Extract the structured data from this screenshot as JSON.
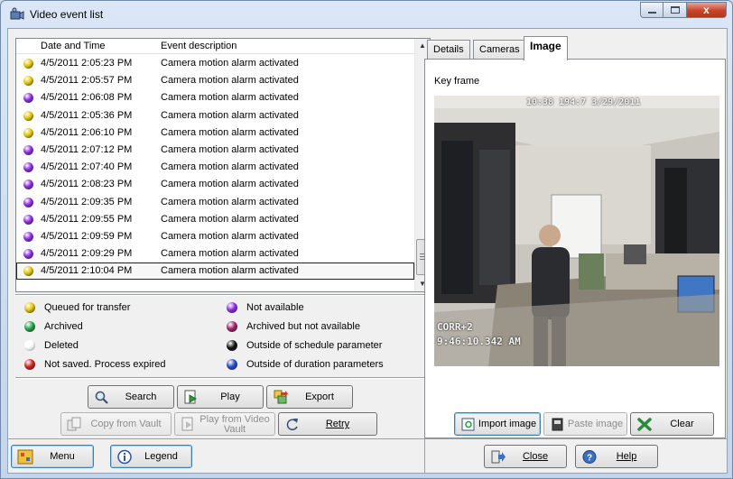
{
  "window": {
    "title": "Video event list",
    "close_glyph": "x"
  },
  "list": {
    "columns": [
      "Date and Time",
      "Event description"
    ],
    "rows": [
      {
        "datetime": "4/5/2011 2:05:23 PM",
        "description": "Camera motion alarm activated",
        "status": "queued"
      },
      {
        "datetime": "4/5/2011 2:05:57 PM",
        "description": "Camera motion alarm activated",
        "status": "queued"
      },
      {
        "datetime": "4/5/2011 2:06:08 PM",
        "description": "Camera motion alarm activated",
        "status": "not-available"
      },
      {
        "datetime": "4/5/2011 2:05:36 PM",
        "description": "Camera motion alarm activated",
        "status": "queued"
      },
      {
        "datetime": "4/5/2011 2:06:10 PM",
        "description": "Camera motion alarm activated",
        "status": "queued"
      },
      {
        "datetime": "4/5/2011 2:07:12 PM",
        "description": "Camera motion alarm activated",
        "status": "not-available"
      },
      {
        "datetime": "4/5/2011 2:07:40 PM",
        "description": "Camera motion alarm activated",
        "status": "not-available"
      },
      {
        "datetime": "4/5/2011 2:08:23 PM",
        "description": "Camera motion alarm activated",
        "status": "not-available"
      },
      {
        "datetime": "4/5/2011 2:09:35 PM",
        "description": "Camera motion alarm activated",
        "status": "not-available"
      },
      {
        "datetime": "4/5/2011 2:09:55 PM",
        "description": "Camera motion alarm activated",
        "status": "not-available"
      },
      {
        "datetime": "4/5/2011 2:09:59 PM",
        "description": "Camera motion alarm activated",
        "status": "not-available"
      },
      {
        "datetime": "4/5/2011 2:09:29 PM",
        "description": "Camera motion alarm activated",
        "status": "not-available"
      },
      {
        "datetime": "4/5/2011 2:10:04 PM",
        "description": "Camera motion alarm activated",
        "status": "queued",
        "selected": true
      }
    ]
  },
  "legend": [
    {
      "label": "Queued for transfer",
      "color": "#e2c600",
      "icon": "yellow-dot-icon"
    },
    {
      "label": "Not available",
      "color": "#8a2be2",
      "icon": "purple-dot-icon"
    },
    {
      "label": "Archived",
      "color": "#22a447",
      "icon": "green-dot-icon"
    },
    {
      "label": "Archived but not available",
      "color": "#a0206a",
      "icon": "magenta-dot-icon"
    },
    {
      "label": "Deleted",
      "color": "#ffffff",
      "icon": "white-dot-icon"
    },
    {
      "label": "Outside of schedule parameter",
      "color": "#111111",
      "icon": "black-dot-icon"
    },
    {
      "label": "Not saved. Process expired",
      "color": "#d0201c",
      "icon": "red-dot-icon"
    },
    {
      "label": "Outside of duration parameters",
      "color": "#2a47c8",
      "icon": "blue-dot-icon"
    }
  ],
  "actions": {
    "search": "Search",
    "play": "Play",
    "export": "Export",
    "copy_from_vault": "Copy from Vault",
    "play_from_video_vault": "Play from Video Vault",
    "retry": "Retry"
  },
  "tabs": [
    "Details",
    "Cameras",
    "Image"
  ],
  "image_tab": {
    "key_frame_label": "Key frame",
    "overlay_timestamp": "10:38 194:7 3/29/2011",
    "overlay_camera": "CORR+2",
    "overlay_time": "9:46:10.342 AM",
    "import_image": "Import image",
    "paste_image": "Paste image",
    "clear": "Clear"
  },
  "footer": {
    "menu": "Menu",
    "legend": "Legend",
    "close": "Close",
    "help": "Help"
  },
  "colors": {
    "queued": "#e2c600",
    "not-available": "#8a2be2"
  }
}
